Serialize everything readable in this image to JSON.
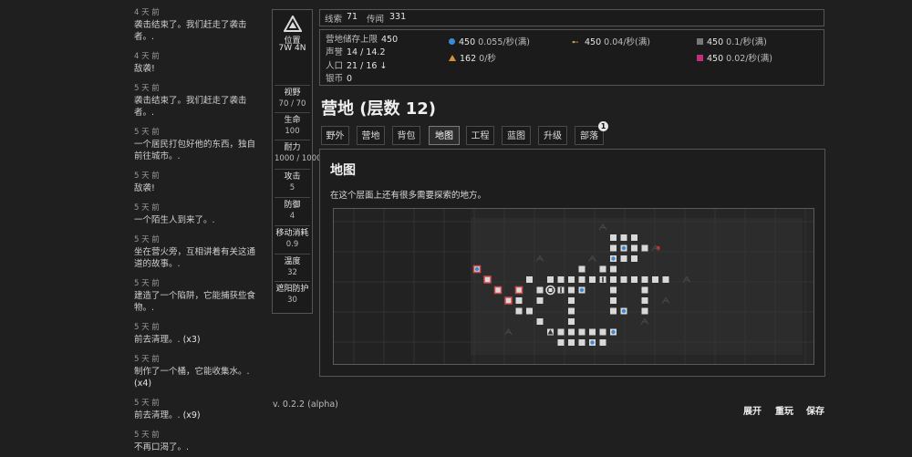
{
  "log": [
    {
      "time": "4 天 前",
      "text": "袭击结束了。我们赶走了袭击者。.",
      "count": ""
    },
    {
      "time": "4 天 前",
      "text": "敌袭!",
      "count": ""
    },
    {
      "time": "5 天 前",
      "text": "袭击结束了。我们赶走了袭击者。.",
      "count": ""
    },
    {
      "time": "5 天 前",
      "text": "一个居民打包好他的东西，独自前往城市。.",
      "count": ""
    },
    {
      "time": "5 天 前",
      "text": "敌袭!",
      "count": ""
    },
    {
      "time": "5 天 前",
      "text": "一个陌生人到来了。.",
      "count": ""
    },
    {
      "time": "5 天 前",
      "text": "坐在营火旁，互相讲着有关这通道的故事。.",
      "count": ""
    },
    {
      "time": "5 天 前",
      "text": "建造了一个陷阱，它能捕获些食物。.",
      "count": ""
    },
    {
      "time": "5 天 前",
      "text": "前去清理。.",
      "count": "(x3)"
    },
    {
      "time": "5 天 前",
      "text": "制作了一个桶，它能收集水。.",
      "count": "(x4)"
    },
    {
      "time": "5 天 前",
      "text": "前去清理。.",
      "count": "(x9)"
    },
    {
      "time": "5 天 前",
      "text": "不再口渴了。.",
      "count": ""
    },
    {
      "time": "5 天 前",
      "text": "",
      "count": ""
    }
  ],
  "position": {
    "label": "位置",
    "value": "7W 4N"
  },
  "stats": [
    {
      "key": "视野",
      "value": "70 / 70"
    },
    {
      "key": "生命",
      "value": "100"
    },
    {
      "key": "耐力",
      "value": "1000 / 1000 ↑"
    },
    {
      "key": "攻击",
      "value": "5"
    },
    {
      "key": "防御",
      "value": "4"
    },
    {
      "key": "移动消耗",
      "value": "0.9"
    },
    {
      "key": "温度",
      "value": "32"
    },
    {
      "key": "遮阳防护",
      "value": "30"
    }
  ],
  "clues": {
    "label": "线索",
    "value": "71",
    "rumor_label": "传闻",
    "rumor_value": "331"
  },
  "camp": {
    "storage_label": "营地储存上限",
    "storage_value": "450",
    "reputation_label": "声誉",
    "reputation_value": "14 / 14.2",
    "population_label": "人口",
    "population_value": "21 / 16 ↓",
    "silver_label": "银币",
    "silver_value": "0"
  },
  "resources": [
    {
      "icon": "blue-dot-icon",
      "color": "#3a8ad6",
      "amount": "450",
      "rate": "0.055/秒(满)"
    },
    {
      "icon": "arrow-icon",
      "color": "#c8a050",
      "amount": "450",
      "rate": "0.04/秒(满)"
    },
    {
      "icon": "gray-square-icon",
      "color": "#777777",
      "amount": "450",
      "rate": "0.1/秒(满)"
    },
    {
      "icon": "orange-triangle-icon",
      "color": "#d8913a",
      "amount": "162",
      "rate": "0/秒"
    },
    {
      "icon": "magenta-square-icon",
      "color": "#c2307a",
      "amount": "450",
      "rate": "0.02/秒(满)"
    }
  ],
  "page_title": "营地 (层数 12)",
  "tabs": [
    "野外",
    "营地",
    "背包",
    "地图",
    "工程",
    "蓝图",
    "升级",
    "部落"
  ],
  "tab_badge": "1",
  "panel": {
    "title": "地图",
    "desc": "在这个层面上还有很多需要探索的地方。"
  },
  "version": "v. 0.2.2 (alpha)",
  "footer": {
    "expand": "展开",
    "restart": "重玩",
    "save": "保存"
  }
}
